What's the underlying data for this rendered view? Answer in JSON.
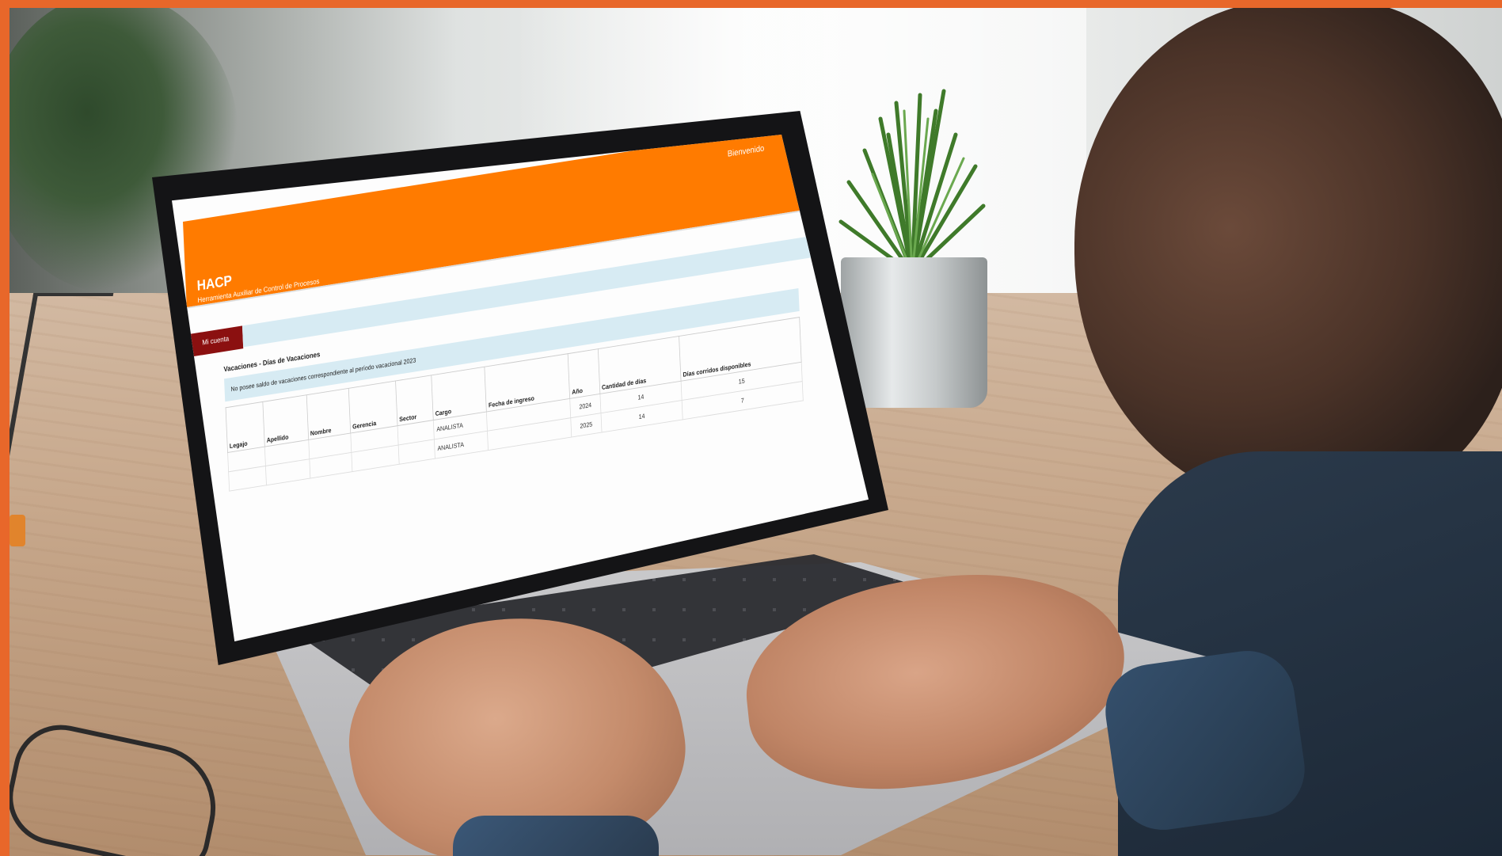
{
  "app": {
    "welcome": "Bienvenido",
    "subnote": "",
    "brand": "HACP",
    "subtitle": "Herramienta Auxiliar de Control de Procesos",
    "tab_label": "Mi cuenta",
    "banner_close": "×",
    "section_title": "Vacaciones - Días de Vacaciones",
    "info_message": "No posee saldo de vacaciones correspondiente al período vacacional 2023",
    "table": {
      "headers": [
        "Legajo",
        "Apellido",
        "Nombre",
        "Gerencia",
        "Sector",
        "Cargo",
        "Fecha de ingreso",
        "Año",
        "Cantidad de días",
        "Días corridos disponibles"
      ],
      "rows": [
        [
          "",
          "",
          "",
          "",
          "",
          "ANALISTA",
          "",
          "2024",
          "14",
          "15"
        ],
        [
          "",
          "",
          "",
          "",
          "",
          "ANALISTA",
          "",
          "2025",
          "14",
          "7"
        ]
      ]
    }
  },
  "colors": {
    "header_orange": "#ff7b00",
    "tab_red": "#8b1010",
    "banner_blue": "#d7ebf3",
    "frame_orange": "#e8672a"
  }
}
